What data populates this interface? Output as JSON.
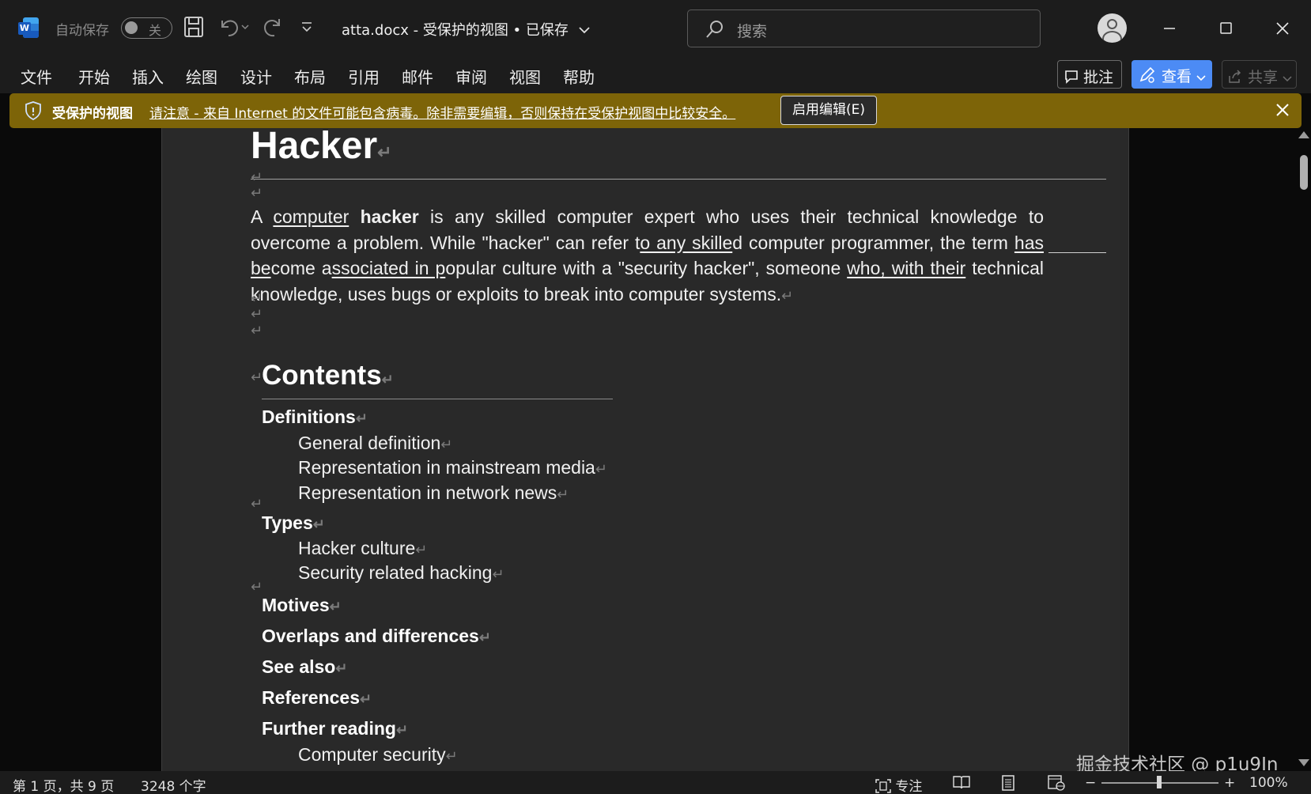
{
  "titlebar": {
    "app_icon_letter": "W",
    "autosave_label": "自动保存",
    "autosave_state": "关",
    "doc_title": "atta.docx  -  受保护的视图 • 已保存",
    "search_placeholder": "搜索"
  },
  "ribbon": {
    "tabs": [
      "文件",
      "开始",
      "插入",
      "绘图",
      "设计",
      "布局",
      "引用",
      "邮件",
      "审阅",
      "视图",
      "帮助"
    ],
    "comment_label": "批注",
    "view_label": "查看",
    "share_label": "共享"
  },
  "protected_view": {
    "title": "受保护的视图",
    "message": "请注意 - 来自 Internet 的文件可能包含病毒。除非需要编辑，否则保持在受保护视图中比较安全。",
    "enable_button": "启用编辑(E)",
    "bar_color": "#7d6408"
  },
  "document": {
    "heading": "Hacker",
    "paragraph": {
      "p1": "A ",
      "u1": "computer",
      "p2": " ",
      "b1": "hacker",
      "p3": " is any skilled computer expert who uses their technical knowledge to overcome a problem. While \"hacker\" can refer t",
      "u2": "o any skille",
      "p4": "d computer programmer, the term ",
      "u3": "has be",
      "p5": "come a",
      "u4": "ssociated in p",
      "p6": "opular culture with a \"security hacker\", someone ",
      "u5": "who, with their",
      "p7": " technical knowledge, uses bugs or exploits to break into computer systems."
    },
    "paragraph_mark": "↵",
    "contents_heading": "Contents",
    "toc": {
      "definitions": "Definitions",
      "general_definition": "General definition",
      "mainstream_media": "Representation in mainstream media",
      "network_news": "Representation in network news",
      "types": "Types",
      "hacker_culture": "Hacker culture",
      "security_hacking": "Security related hacking",
      "motives": "Motives",
      "overlaps": "Overlaps and differences",
      "see_also": "See also",
      "references": "References",
      "further_reading": "Further reading",
      "computer_security": "Computer security"
    }
  },
  "watermark": "掘金技术社区 @ p1u9In",
  "statusbar": {
    "page_info": "第 1 页，共 9 页",
    "word_count": "3248 个字",
    "focus_label": "专注",
    "zoom_minus": "−",
    "zoom_plus": "+",
    "zoom_level": "100%",
    "zoom_percent": 100
  },
  "colors": {
    "accent": "#4c8bf5",
    "chrome": "#1c1c1c",
    "page": "#292929"
  }
}
